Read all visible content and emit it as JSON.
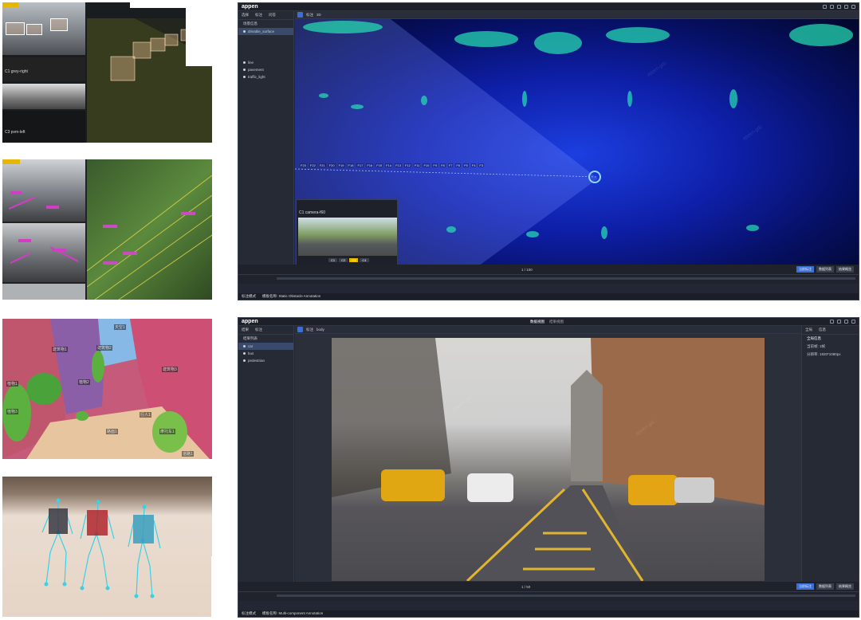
{
  "top_app": {
    "logo": "appen",
    "panel_tabs": [
      "选择",
      "标注",
      "问答"
    ],
    "panel_header": "场景信息",
    "selected_item": "drivable_surface",
    "items": [
      "line",
      "pavement",
      "traffic_light"
    ],
    "toolbar": [
      "标注",
      "3D"
    ],
    "frame_labels": [
      "F23",
      "F22",
      "F21",
      "F20",
      "F19",
      "F18",
      "F17",
      "F16",
      "F15",
      "F14",
      "F13",
      "F12",
      "F11",
      "F10",
      "F9",
      "F8",
      "F7",
      "F6",
      "F5",
      "F4",
      "F3"
    ],
    "camera_label": "C1 camera-f60",
    "camera_tabs": [
      "C1",
      "C2",
      "C3",
      "C4"
    ],
    "pager": "1 / 100",
    "right_buttons": [
      "当前标注",
      "数据列表",
      "结果概览"
    ],
    "footer_mode": "标注模式",
    "footer_task": "模板名称: Static Obstacle Annotation"
  },
  "bottom_app": {
    "logo": "appen",
    "center_tabs": [
      "数据视图",
      "结果视图"
    ],
    "panel_tabs": [
      "结果",
      "标注"
    ],
    "panel_header": "结果列表",
    "items": [
      "car",
      "bus",
      "pedestrian"
    ],
    "toolbar": [
      "标注",
      "body"
    ],
    "side_tabs": [
      "全局",
      "信息"
    ],
    "side_header": "全局信息",
    "side_rows": [
      "当前帧: 1帧",
      "分辨率: 1920*1080px"
    ],
    "pager": "1 / 50",
    "right_buttons": [
      "当前标注",
      "数据列表",
      "结果概览"
    ],
    "footer_mode": "标注模式",
    "footer_task": "模板名称: Multi-component Annotation"
  },
  "thumb1": {
    "labels": [
      "C1 grey-right",
      "C3 pvm-left"
    ]
  },
  "thumb3": {
    "labels": [
      "天空1",
      "建筑物1",
      "植物1",
      "建筑物2",
      "植物2",
      "建筑物3",
      "植物3",
      "路面1",
      "摩托车1",
      "行人1",
      "道路1"
    ]
  }
}
